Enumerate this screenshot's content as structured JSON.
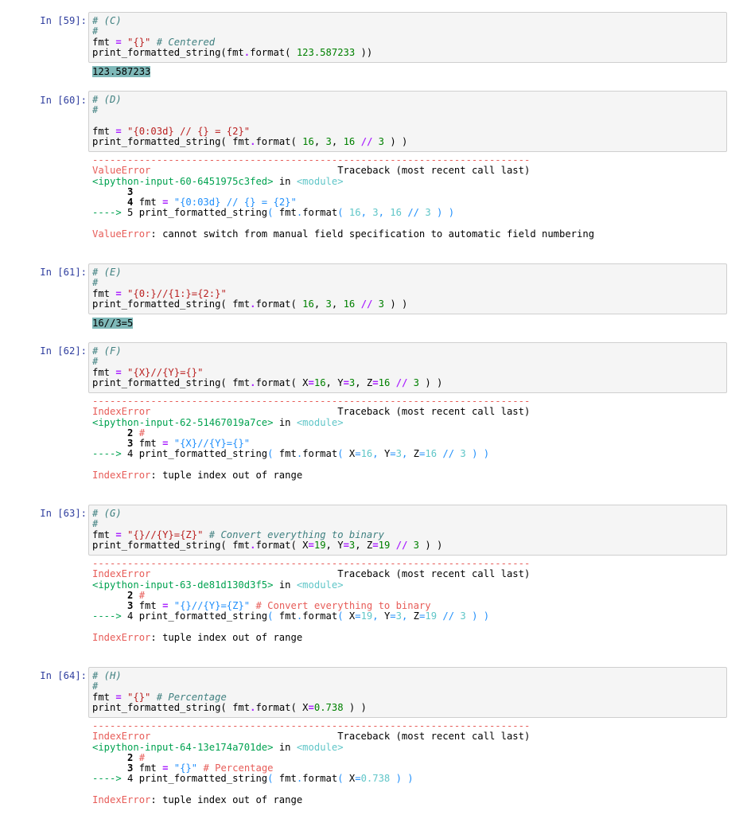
{
  "cells": [
    {
      "prompt": "In [59]:",
      "code": [
        "# (C)",
        "#",
        "fmt = \"{}\" # Centered",
        "print_formatted_string(fmt.format( 123.587233 ))"
      ],
      "output": "123.587233"
    },
    {
      "prompt": "In [60]:",
      "code": [
        "# (D)",
        "#",
        "",
        "fmt = \"{0:03d} // {} = {2}\"",
        "print_formatted_string( fmt.format( 16, 3, 16 // 3 ) )"
      ],
      "tb": {
        "dashes": "---------------------------------------------------------------------------",
        "etype": "ValueError",
        "header": "Traceback (most recent call last)",
        "input": "<ipython-input-60-6451975c3fed>",
        "in": "in",
        "module": "<module>",
        "l1": "3",
        "l2": "4 fmt = \"{0:03d} // {} = {2}\"",
        "l3": "5 print_formatted_string( fmt.format( 16, 3, 16 // 3 ) )",
        "msg": "cannot switch from manual field specification to automatic field numbering"
      }
    },
    {
      "prompt": "In [61]:",
      "code": [
        "# (E)",
        "#",
        "fmt = \"{0:}//{1:}={2:}\"",
        "print_formatted_string( fmt.format( 16, 3, 16 // 3 ) )"
      ],
      "output": "16//3=5"
    },
    {
      "prompt": "In [62]:",
      "code": [
        "# (F)",
        "#",
        "fmt = \"{X}//{Y}={}\"",
        "print_formatted_string( fmt.format( X=16, Y=3, Z=16 // 3 ) )"
      ],
      "tb": {
        "etype": "IndexError",
        "input": "<ipython-input-62-51467019a7ce>",
        "l1": "2 #",
        "l2": "3 fmt = \"{X}//{Y}={}\"",
        "l3": "4 print_formatted_string( fmt.format( X=16, Y=3, Z=16 // 3 ) )",
        "msg": "tuple index out of range"
      }
    },
    {
      "prompt": "In [63]:",
      "code": [
        "# (G)",
        "#",
        "fmt = \"{}//{Y}={Z}\" # Convert everything to binary",
        "print_formatted_string( fmt.format( X=19, Y=3, Z=19 // 3 ) )"
      ],
      "tb": {
        "etype": "IndexError",
        "input": "<ipython-input-63-de81d130d3f5>",
        "l1": "2 #",
        "l2": "3 fmt = \"{}//{Y}={Z}\" # Convert everything to binary",
        "l3": "4 print_formatted_string( fmt.format( X=19, Y=3, Z=19 // 3 ) )",
        "msg": "tuple index out of range"
      }
    },
    {
      "prompt": "In [64]:",
      "code": [
        "# (H)",
        "#",
        "fmt = \"{}\" # Percentage",
        "print_formatted_string( fmt.format( X=0.738 ) )"
      ],
      "tb": {
        "etype": "IndexError",
        "input": "<ipython-input-64-13e174a701de>",
        "l1": "2 #",
        "l2": "3 fmt = \"{}\" # Percentage",
        "l3": "4 print_formatted_string( fmt.format( X=0.738 ) )",
        "msg": "tuple index out of range"
      }
    }
  ],
  "arrow": "---->",
  "colon": ":"
}
